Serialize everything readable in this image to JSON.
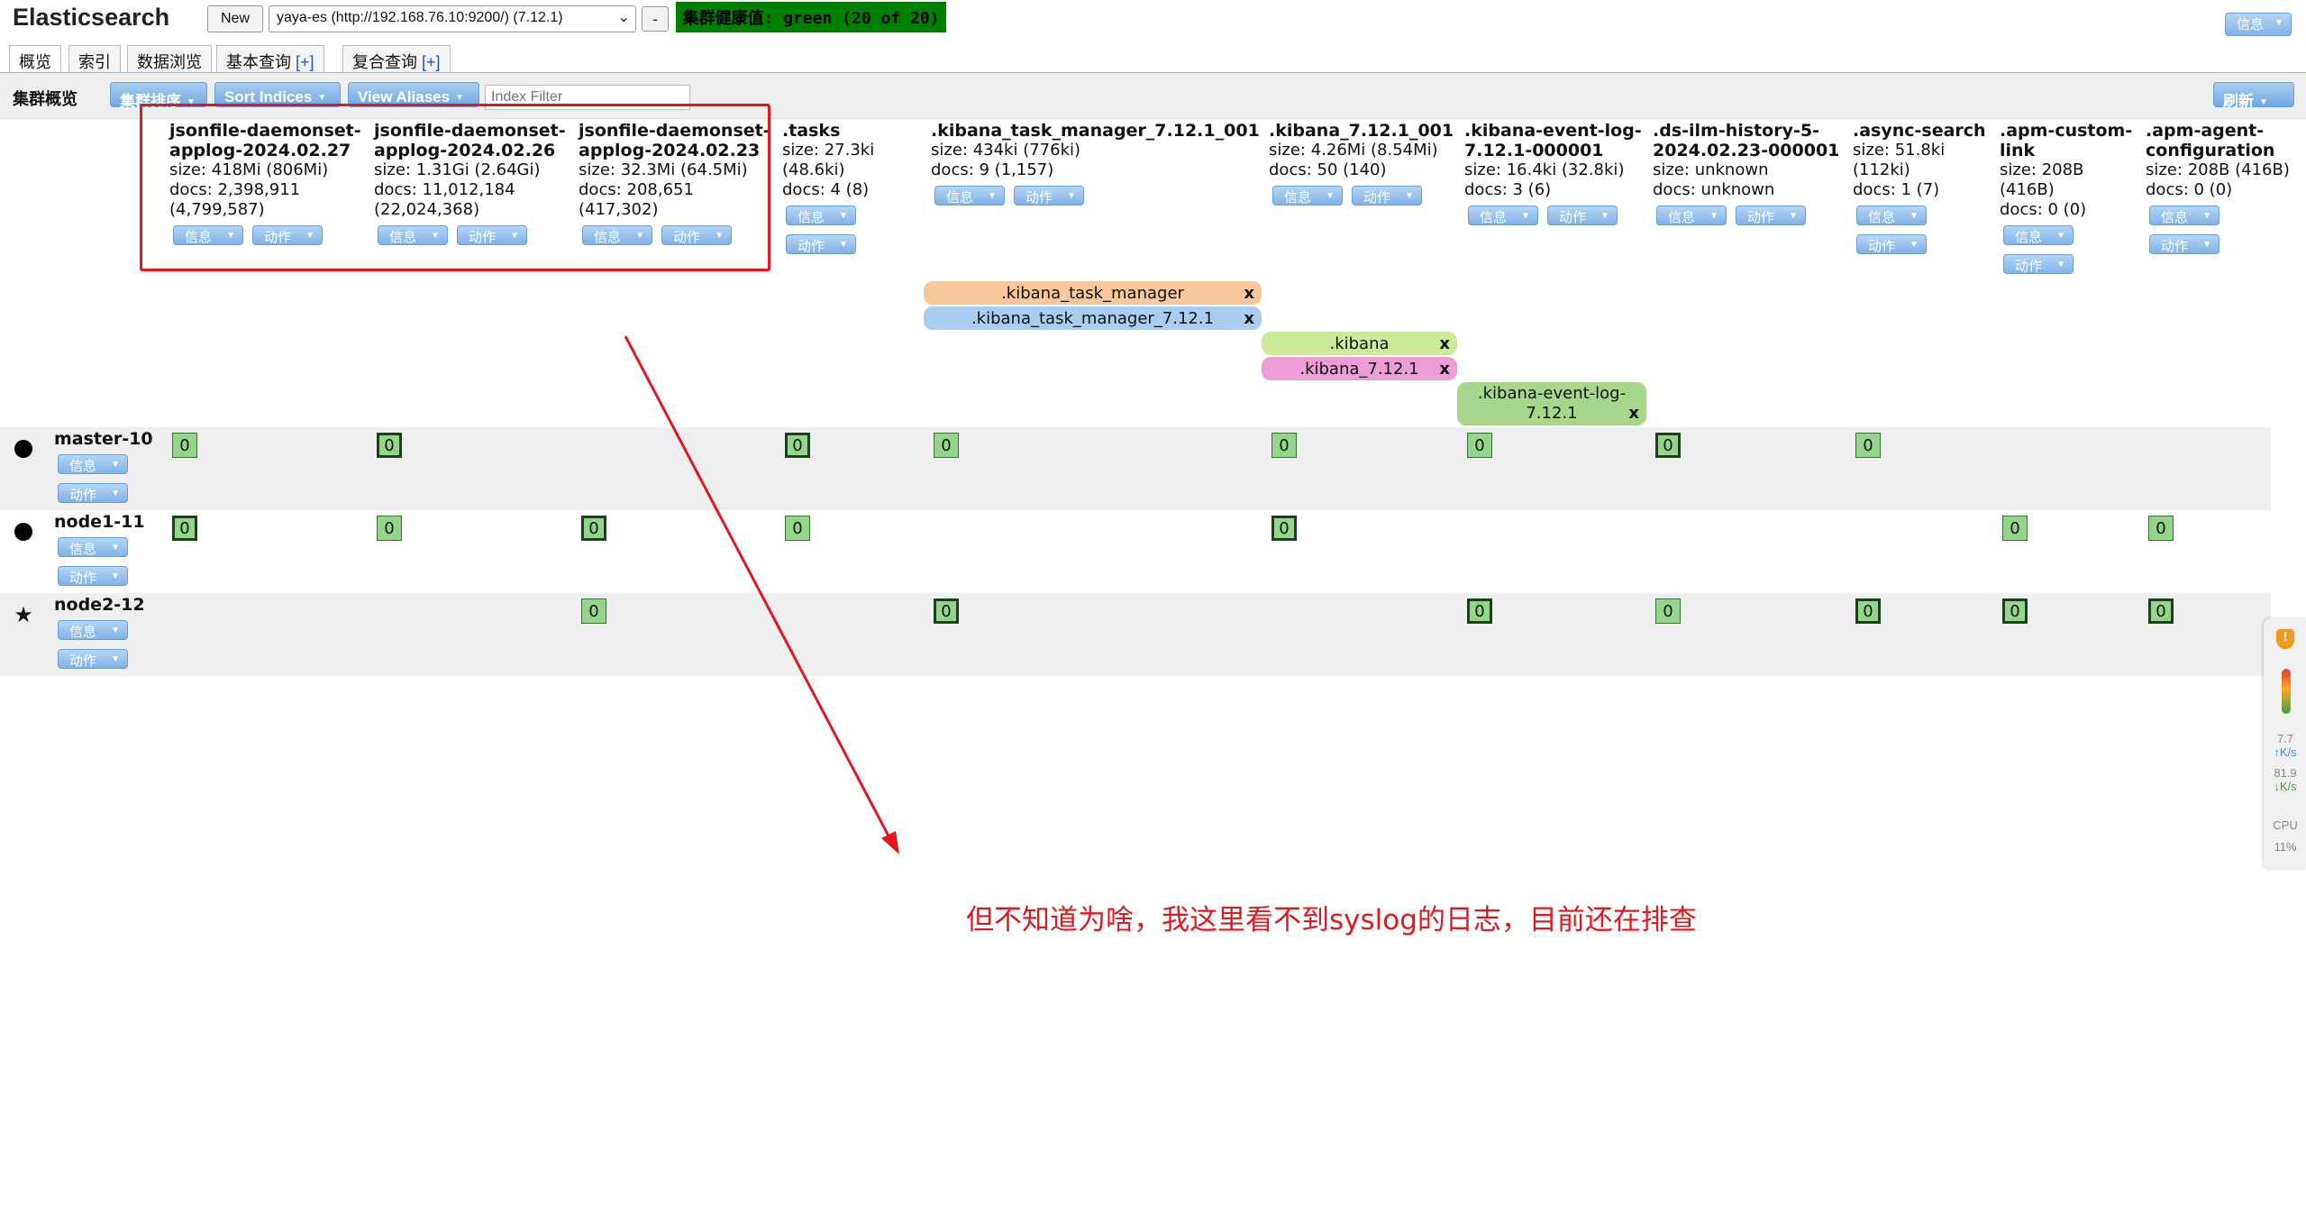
{
  "header": {
    "brand": "Elasticsearch",
    "new_label": "New",
    "connection": "yaya-es (http://192.168.76.10:9200/) (7.12.1)",
    "disconnect_label": "-",
    "health": "集群健康值: green (20 of 20)",
    "info_label": "信息"
  },
  "tabs": [
    {
      "label": "概览"
    },
    {
      "label": "索引"
    },
    {
      "label": "数据浏览"
    },
    {
      "label": "基本查询",
      "plus": "[+]"
    },
    {
      "label": "复合查询",
      "plus": "[+]"
    }
  ],
  "toolbar": {
    "title": "集群概览",
    "sort_cluster": "集群排序",
    "sort_indices": "Sort Indices",
    "view_aliases": "View Aliases",
    "filter_placeholder": "Index Filter",
    "refresh": "刷新"
  },
  "buttons": {
    "info": "信息",
    "action": "动作"
  },
  "indices": [
    {
      "name1": "jsonfile-daemonset-",
      "name2": "applog-2024.02.27",
      "l1": "size: 418Mi (806Mi)",
      "l2": "docs: 2,398,911",
      "l3": "(4,799,587)"
    },
    {
      "name1": "jsonfile-daemonset-",
      "name2": "applog-2024.02.26",
      "l1": "size: 1.31Gi (2.64Gi)",
      "l2": "docs: 11,012,184",
      "l3": "(22,024,368)"
    },
    {
      "name1": "jsonfile-daemonset-",
      "name2": "applog-2024.02.23",
      "l1": "size: 32.3Mi (64.5Mi)",
      "l2": "docs: 208,651",
      "l3": "(417,302)"
    },
    {
      "name1": ".tasks",
      "name2": "",
      "l1": "size: 27.3ki",
      "l2": "(48.6ki)",
      "l3": "docs: 4 (8)"
    },
    {
      "name1": ".kibana_task_manager_7.12.1_001",
      "name2": "",
      "l1": "size: 434ki (776ki)",
      "l2": "docs: 9 (1,157)",
      "l3": ""
    },
    {
      "name1": ".kibana_7.12.1_001",
      "name2": "",
      "l1": "size: 4.26Mi (8.54Mi)",
      "l2": "docs: 50 (140)",
      "l3": ""
    },
    {
      "name1": ".kibana-event-log-",
      "name2": "7.12.1-000001",
      "l1": "size: 16.4ki (32.8ki)",
      "l2": "docs: 3 (6)",
      "l3": ""
    },
    {
      "name1": ".ds-ilm-history-5-",
      "name2": "2024.02.23-000001",
      "l1": "size: unknown",
      "l2": "docs: unknown",
      "l3": ""
    },
    {
      "name1": ".async-search",
      "name2": "",
      "l1": "size: 51.8ki",
      "l2": "(112ki)",
      "l3": "docs: 1 (7)"
    },
    {
      "name1": ".apm-custom-",
      "name2": "link",
      "l1": "size: 208B",
      "l2": "(416B)",
      "l3": "docs: 0 (0)"
    },
    {
      "name1": ".apm-agent-",
      "name2": "configuration",
      "l1": "size: 208B (416B)",
      "l2": "docs: 0 (0)",
      "l3": ""
    }
  ],
  "aliases": [
    {
      "label": ".kibana_task_manager",
      "x": "x",
      "color": "#f9c79a"
    },
    {
      "label": ".kibana_task_manager_7.12.1",
      "x": "x",
      "color": "#a9cdf0"
    },
    {
      "label": ".kibana",
      "x": "x",
      "color": "#cde99a"
    },
    {
      "label": ".kibana_7.12.1",
      "x": "x",
      "color": "#ec9ed4"
    },
    {
      "label1": ".kibana-event-log-",
      "label2": "7.12.1",
      "x": "x",
      "color": "#a6d78a"
    }
  ],
  "nodes": [
    {
      "name": "master-10",
      "icon": "circle-icon"
    },
    {
      "name": "node1-11",
      "icon": "circle-icon"
    },
    {
      "name": "node2-12",
      "icon": "star-icon"
    }
  ],
  "shard_value": "0",
  "annotation": "但不知道为啥，我这里看不到syslog的日志，目前还在排查",
  "side_widget": {
    "shield": "!",
    "up_value": "7.7",
    "up_unit": "K/s",
    "down_value": "81.9",
    "down_unit": "K/s",
    "cpu_label": "CPU",
    "cpu_value": "11%"
  }
}
